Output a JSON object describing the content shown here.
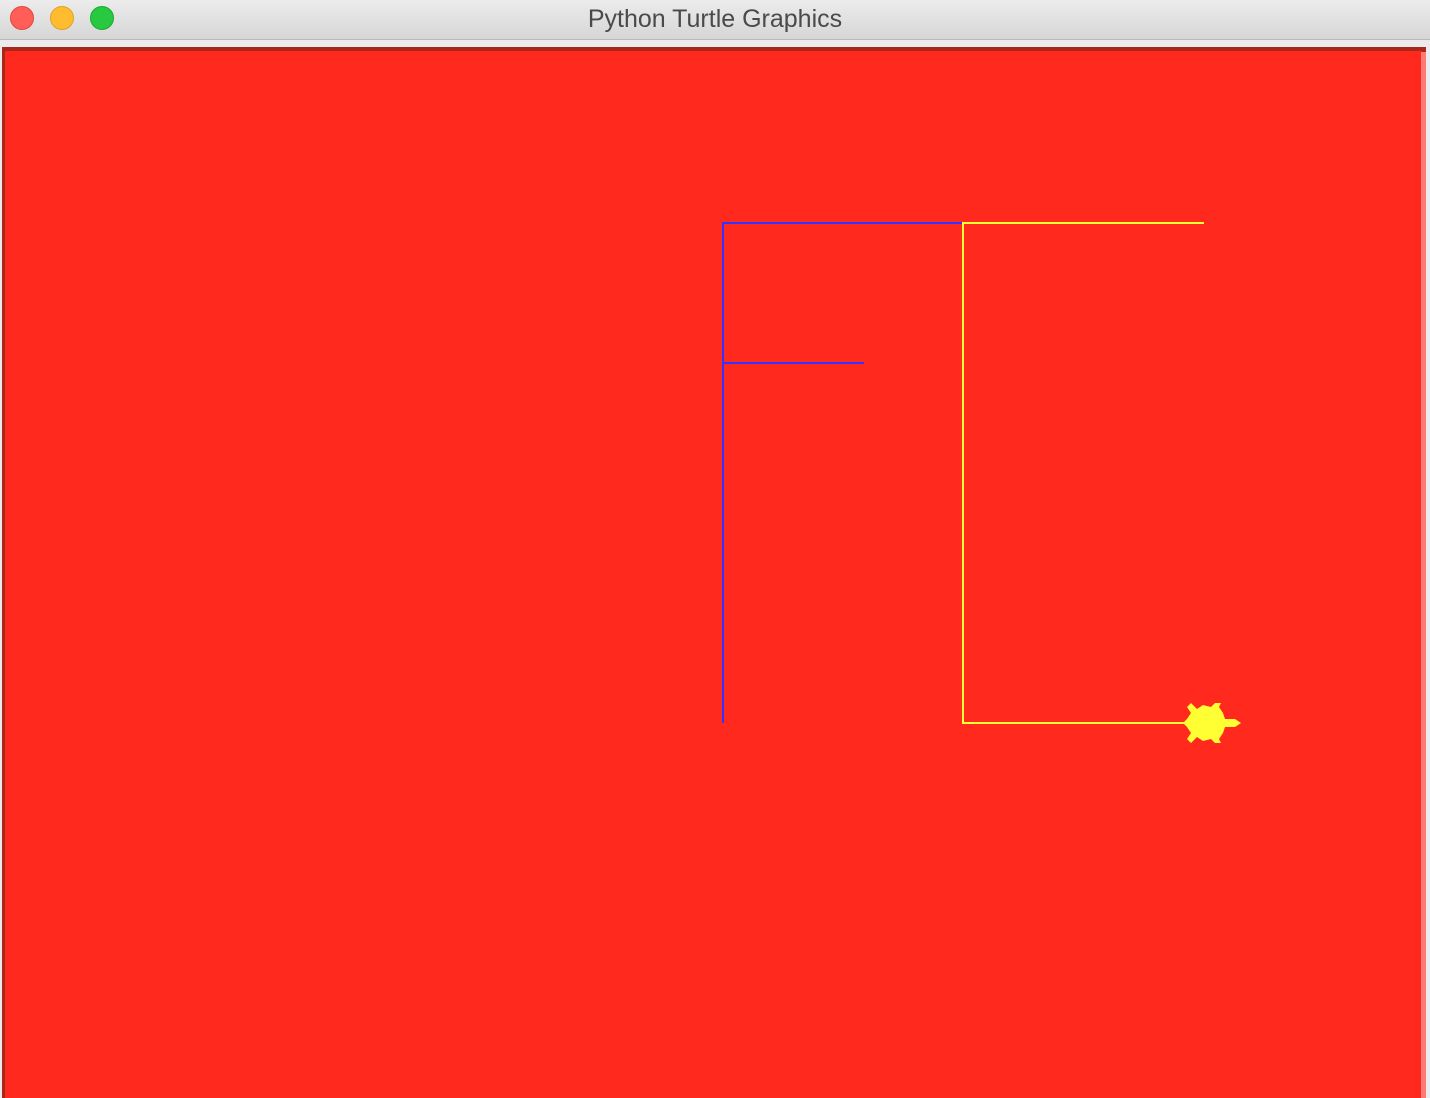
{
  "window": {
    "title": "Python Turtle Graphics",
    "controls": [
      "close",
      "minimize",
      "zoom"
    ]
  },
  "canvas": {
    "background_color": "#ff2a1d",
    "paths": [
      {
        "name": "blue-path",
        "color": "#3333ff"
      },
      {
        "name": "yellow-path",
        "color": "#ffff33"
      }
    ],
    "turtle": {
      "shape": "turtle",
      "color": "#ffff33",
      "heading": "east"
    }
  }
}
